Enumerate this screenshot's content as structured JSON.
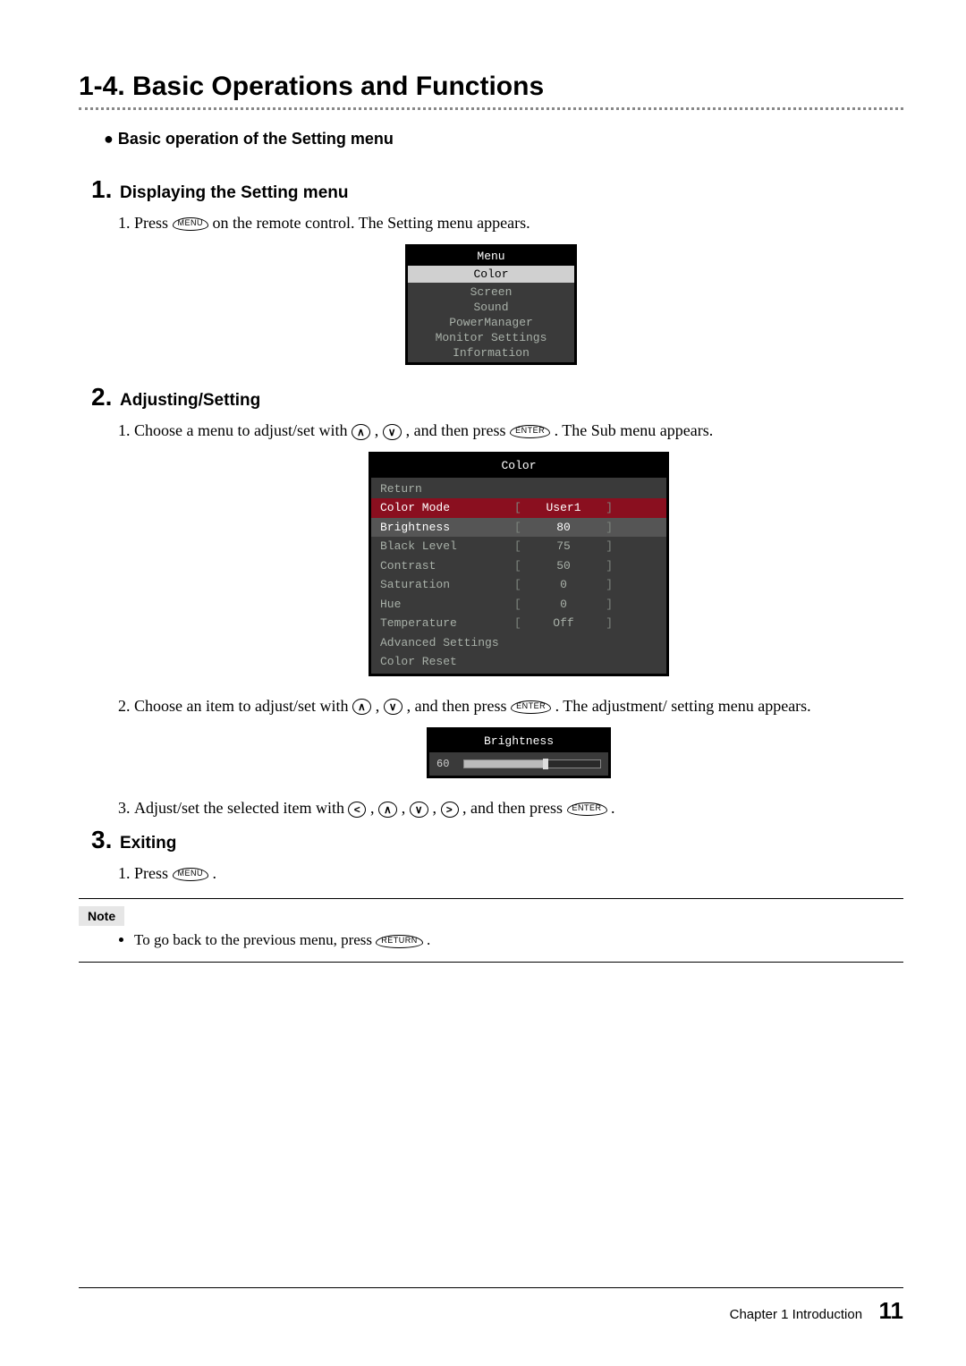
{
  "section_number": "1-4.",
  "section_title": "Basic Operations and Functions",
  "bullet_heading": "Basic operation of the Setting menu",
  "steps": {
    "s1": {
      "num": "1.",
      "title": "Displaying the Setting menu",
      "line1_a": "Press ",
      "line1_b": " on the remote control. The Setting menu appears."
    },
    "s2": {
      "num": "2.",
      "title": "Adjusting/Setting",
      "line1_a": "Choose a menu to adjust/set with ",
      "line1_b": ", ",
      "line1_c": ", and then press ",
      "line1_d": ". The Sub menu appears.",
      "line2_a": "Choose an item to adjust/set with ",
      "line2_b": ", ",
      "line2_c": ", and then press ",
      "line2_d": ". The adjustment/ setting menu appears.",
      "line3_a": "Adjust/set the selected item with ",
      "line3_b": ", ",
      "line3_c": ", ",
      "line3_d": ", ",
      "line3_e": ", and then press ",
      "line3_f": "."
    },
    "s3": {
      "num": "3.",
      "title": "Exiting",
      "line1_a": "Press ",
      "line1_b": "."
    }
  },
  "buttons": {
    "menu": "MENU",
    "enter": "ENTER",
    "return": "RETURN",
    "up": "∧",
    "down": "∨",
    "left": "<",
    "right": ">"
  },
  "osd_main": {
    "title": "Menu",
    "selected": "Color",
    "items": [
      "Screen",
      "Sound",
      "PowerManager",
      "Monitor Settings",
      "Information"
    ]
  },
  "osd_color": {
    "title": "Color",
    "return": "Return",
    "rows": [
      {
        "label": "Color Mode",
        "val": "User1",
        "sel": true
      },
      {
        "label": "Brightness",
        "val": "80",
        "hl": true
      },
      {
        "label": "Black Level",
        "val": "75"
      },
      {
        "label": "Contrast",
        "val": "50"
      },
      {
        "label": "Saturation",
        "val": "0"
      },
      {
        "label": "Hue",
        "val": "0"
      },
      {
        "label": "Temperature",
        "val": "Off"
      },
      {
        "label": "Advanced Settings",
        "val": ""
      },
      {
        "label": "Color Reset",
        "val": ""
      }
    ]
  },
  "osd_brightness": {
    "title": "Brightness",
    "value": "60",
    "percent": 60
  },
  "note": {
    "label": "Note",
    "item_a": "To go back to the previous menu, press ",
    "item_b": "."
  },
  "footer": {
    "chapter": "Chapter 1  Introduction",
    "page": "11"
  }
}
